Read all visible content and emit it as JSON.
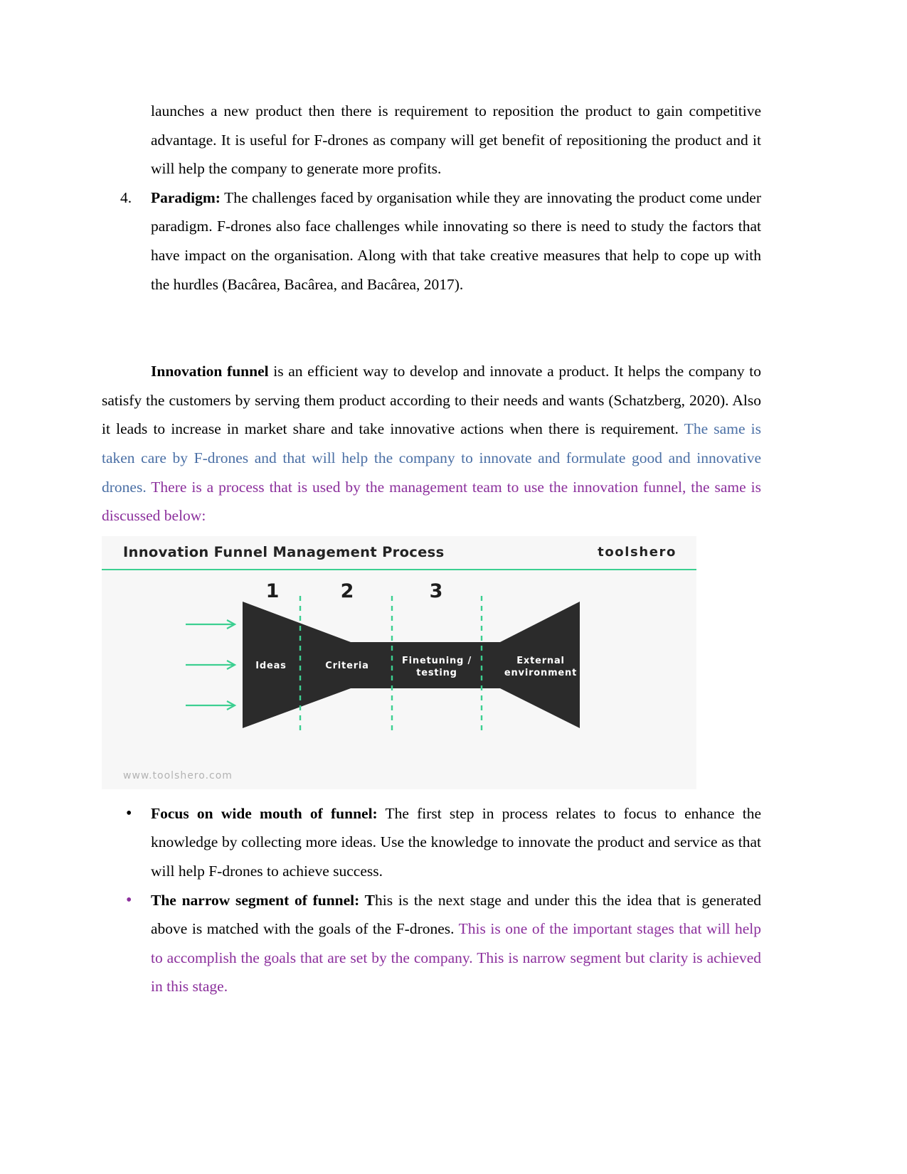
{
  "document": {
    "continued_paragraph": "launches a new product then there is requirement to reposition the product to gain competitive advantage. It is useful for F-drones as company will get benefit of repositioning the product and it will help the company to generate more profits.",
    "numbered_item": {
      "marker": "4.",
      "term": "Paradigm:",
      "text": " The challenges faced by organisation while they are innovating the product come under paradigm. F-drones also face challenges while innovating so there is need to study the factors that have impact on the organisation. Along with that take creative measures that help to cope up with the hurdles (Bacârea, Bacârea, and Bacârea, 2017)."
    },
    "innovation_paragraph": {
      "lead_bold": "Innovation funnel",
      "black_text": " is an efficient way to develop and innovate a product. It helps the company to satisfy the customers by serving them product according to their needs and wants (Schatzberg, 2020). Also it leads to increase in market share and take innovative actions when there is requirement. ",
      "blue_text": "The same is taken care by F-drones and that will help the company to innovate and formulate good and innovative drones. ",
      "purple_text": "There is a process that is used by the management team to use the innovation funnel, the same is discussed below:"
    },
    "figure": {
      "title": "Innovation Funnel Management Process",
      "brand": "toolshero",
      "url": "www.toolshero.com",
      "stage_numbers": [
        "1",
        "2",
        "3"
      ],
      "segment_labels": [
        "Ideas",
        "Criteria",
        "Finetuning /\ntesting",
        "External\nenvironment"
      ],
      "segment_label_1": "Ideas",
      "segment_label_2": "Criteria",
      "segment_label_3_line1": "Finetuning /",
      "segment_label_3_line2": "testing",
      "segment_label_4_line1": "External",
      "segment_label_4_line2": "environment",
      "colors": {
        "funnel_fill": "#2b2b2b",
        "accent_green": "#3ccf91",
        "panel_bg": "#f7f7f7"
      },
      "input_arrow_count": 3
    },
    "bullets": [
      {
        "term": "Focus on wide mouth of funnel:",
        "black_text": " The first step in process relates to focus to enhance the knowledge by collecting more ideas. Use the knowledge to innovate the product and service as that will help F-drones to achieve success.",
        "purple_text": "",
        "marker_color": "#000000"
      },
      {
        "term": "The narrow segment of funnel: T",
        "black_text": "his is the next stage and under this the idea that is generated above is matched with the goals of the F-drones. ",
        "purple_text": "This is one of the important stages that will help to accomplish the goals that are set by the company. This is narrow segment but clarity is achieved in this stage.",
        "marker_color": "#8b2f9c"
      }
    ],
    "colors": {
      "blue_highlight": "#4a6fa5",
      "purple_highlight": "#8b2f9c",
      "body_text": "#000000"
    }
  }
}
